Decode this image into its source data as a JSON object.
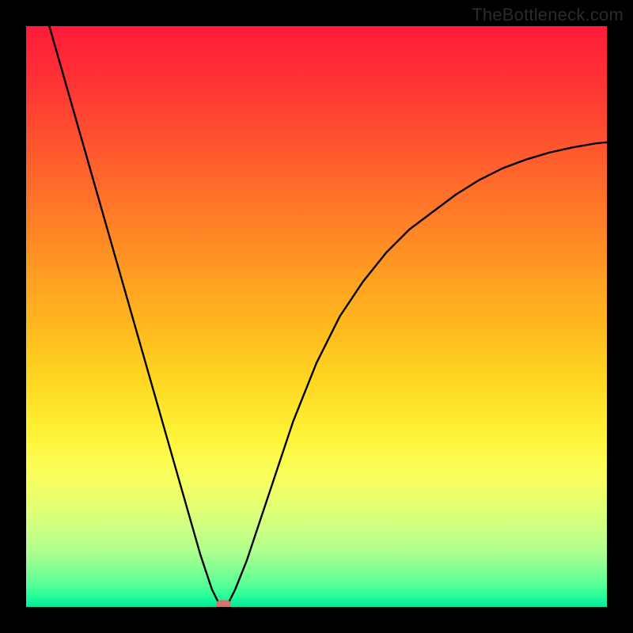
{
  "watermark": "TheBottleneck.com",
  "chart_data": {
    "type": "line",
    "title": "",
    "xlabel": "",
    "ylabel": "",
    "xlim": [
      0,
      100
    ],
    "ylim": [
      0,
      100
    ],
    "grid": false,
    "legend": false,
    "background_gradient": {
      "direction": "vertical",
      "stops": [
        {
          "pos": 0.0,
          "color": "#ff1a3a"
        },
        {
          "pos": 0.5,
          "color": "#ffb61e"
        },
        {
          "pos": 0.75,
          "color": "#fff236"
        },
        {
          "pos": 1.0,
          "color": "#00e999"
        }
      ]
    },
    "series": [
      {
        "name": "bottleneck-curve",
        "x": [
          4,
          6,
          8,
          10,
          12,
          14,
          16,
          18,
          20,
          22,
          24,
          26,
          28,
          30,
          32,
          33,
          34,
          35,
          36,
          38,
          40,
          42,
          44,
          46,
          48,
          50,
          54,
          58,
          62,
          66,
          70,
          74,
          78,
          82,
          86,
          90,
          94,
          98,
          100
        ],
        "y": [
          100,
          93,
          86,
          79,
          72,
          65,
          58,
          51,
          44,
          37,
          30,
          23,
          16,
          9,
          3,
          1,
          0,
          1,
          3,
          8,
          14,
          20,
          26,
          32,
          37,
          42,
          50,
          56,
          61,
          65,
          68,
          71,
          73.5,
          75.5,
          77,
          78.2,
          79.1,
          79.8,
          80
        ]
      }
    ],
    "marker": {
      "name": "optimal-point",
      "x": 34,
      "y": 0.5,
      "color": "#cf776f",
      "shape": "rounded-rect"
    }
  }
}
